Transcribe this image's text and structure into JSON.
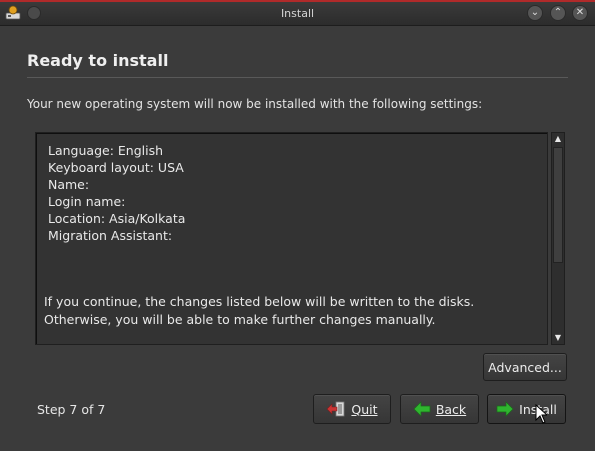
{
  "window": {
    "title": "Install"
  },
  "page": {
    "title": "Ready to install",
    "intro": "Your new operating system will now be installed with the following settings:"
  },
  "summary": {
    "lines": [
      "Language: English",
      "Keyboard layout: USA",
      "Name:",
      "Login name:",
      "Location: Asia/Kolkata",
      "Migration Assistant:"
    ],
    "note_line1": "If you continue, the changes listed below will be written to the disks.",
    "note_line2": "Otherwise, you will be able to make further changes manually."
  },
  "buttons": {
    "advanced": "Advanced...",
    "quit": "Quit",
    "back": "Back",
    "install": "Install"
  },
  "footer": {
    "step": "Step 7 of 7"
  },
  "icons": {
    "app": "installer-icon",
    "minimize": "chevron-down-icon",
    "maximize": "chevron-up-icon",
    "close": "close-icon",
    "quit": "exit-icon",
    "back": "arrow-left-icon",
    "install": "arrow-right-icon"
  },
  "colors": {
    "accent": "#b02a2a",
    "arrow_green": "#2fb52f",
    "quit_red": "#c93434"
  }
}
